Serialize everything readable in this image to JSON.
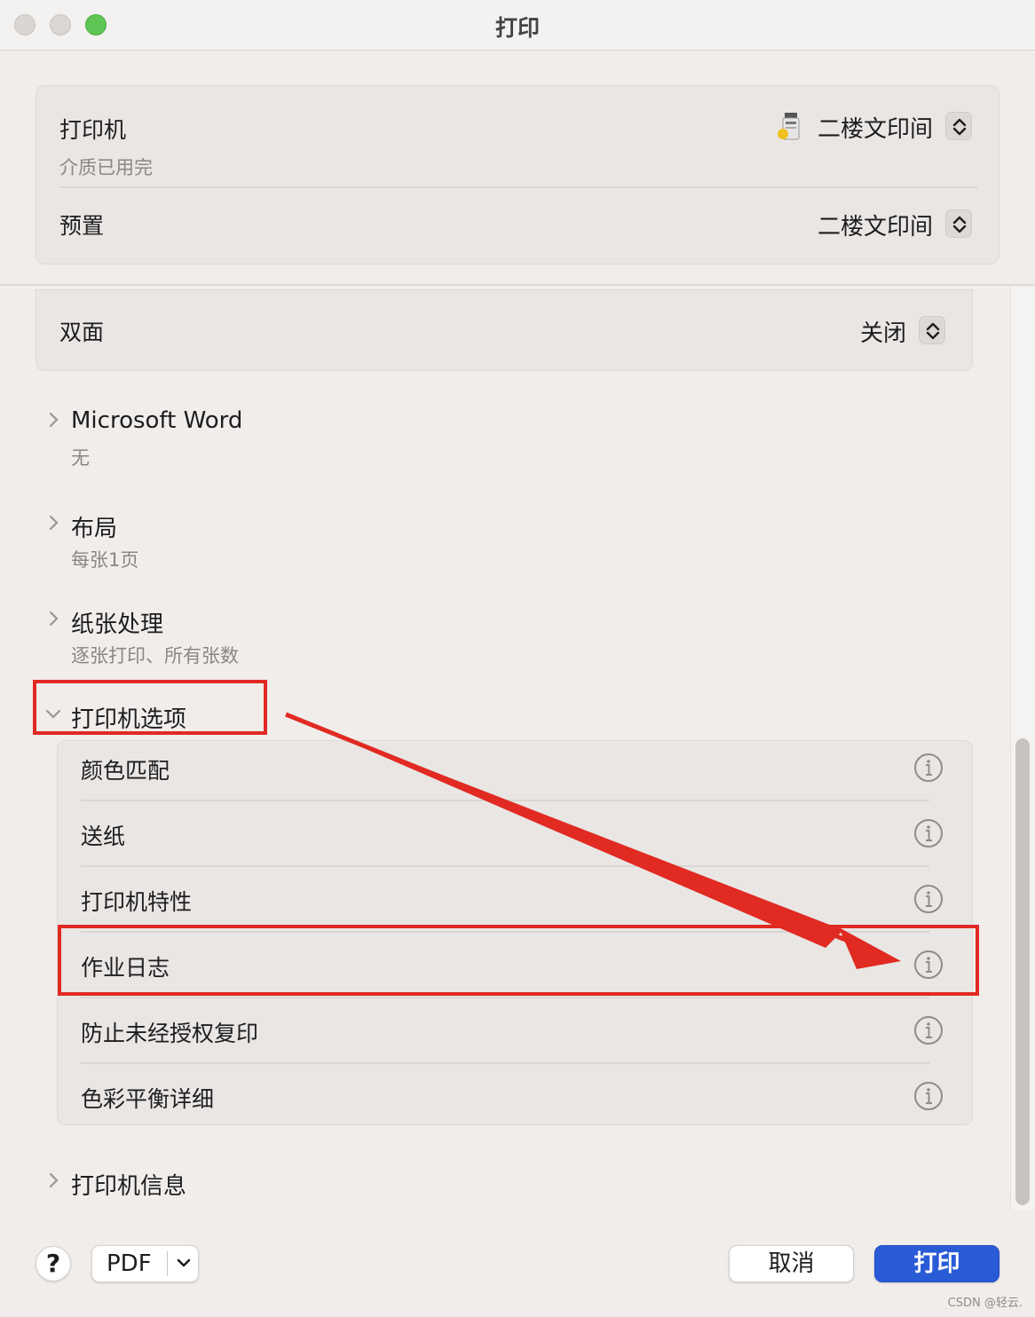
{
  "window": {
    "title": "打印"
  },
  "printer": {
    "label": "打印机",
    "status": "介质已用完",
    "value": "二楼文印间"
  },
  "preset": {
    "label": "预置",
    "value": "二楼文印间"
  },
  "duplex": {
    "label": "双面",
    "value": "关闭"
  },
  "sections": [
    {
      "title": "Microsoft Word",
      "subtitle": "无",
      "expanded": false
    },
    {
      "title": "布局",
      "subtitle": "每张1页",
      "expanded": false
    },
    {
      "title": "纸张处理",
      "subtitle": "逐张打印、所有张数",
      "expanded": false
    },
    {
      "title": "打印机选项",
      "expanded": true
    },
    {
      "title": "打印机信息",
      "expanded": false
    }
  ],
  "printer_options": [
    {
      "label": "颜色匹配"
    },
    {
      "label": "送纸"
    },
    {
      "label": "打印机特性"
    },
    {
      "label": "作业日志"
    },
    {
      "label": "防止未经授权复印"
    },
    {
      "label": "色彩平衡详细"
    }
  ],
  "footer": {
    "help_label": "?",
    "pdf_label": "PDF",
    "cancel_label": "取消",
    "print_label": "打印"
  },
  "watermark": "CSDN @轻云.",
  "colors": {
    "accent": "#2a5bd7",
    "annotation": "#e02a22",
    "window_bg": "#f0edeb"
  }
}
